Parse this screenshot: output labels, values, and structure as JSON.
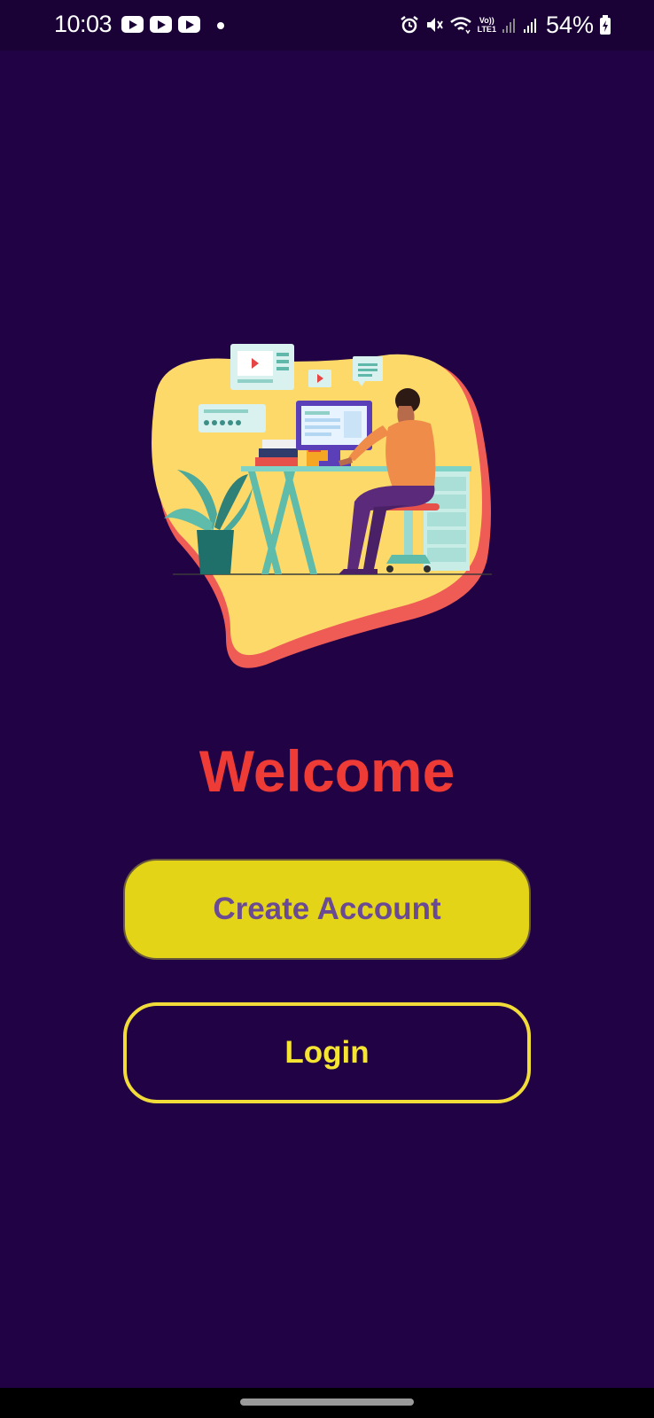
{
  "status_bar": {
    "time": "10:03",
    "notification_icons": [
      "youtube-icon",
      "youtube-icon",
      "youtube-icon",
      "dot-icon"
    ],
    "system_icons": [
      "alarm-icon",
      "mute-icon",
      "wifi-icon",
      "volte-lte-icon",
      "signal-icon",
      "signal-icon",
      "battery-charging-icon"
    ],
    "lte_top": "Vo))",
    "lte_bottom": "LTE1",
    "battery": "54%"
  },
  "illustration": {
    "name": "person-at-desk-illustration"
  },
  "welcome": {
    "title": "Welcome",
    "title_color": "#ef3b36"
  },
  "buttons": {
    "create_account": "Create Account",
    "login": "Login"
  },
  "colors": {
    "background": "#210245",
    "primary_button": "#e3d417",
    "primary_button_text": "#6a4a95",
    "outline_button": "#f2dc3a"
  }
}
